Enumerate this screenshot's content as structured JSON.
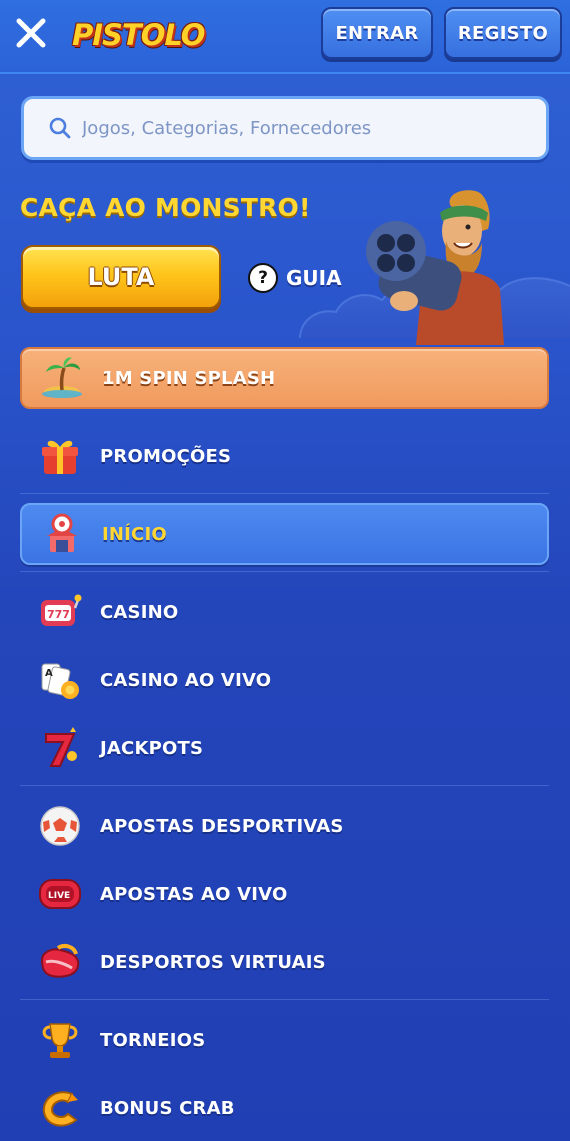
{
  "header": {
    "logo_text": "PISTOLO",
    "login_label": "ENTRAR",
    "register_label": "REGISTO"
  },
  "search": {
    "placeholder": "Jogos, Categorias, Fornecedores"
  },
  "promo": {
    "title": "CAÇA AO MONSTRO!",
    "fight_label": "LUTA",
    "guide_label": "GUIA",
    "guide_icon": "?"
  },
  "menu": {
    "items": [
      {
        "label": "1M SPIN SPLASH",
        "icon": "palm-island-icon"
      },
      {
        "label": "PROMOÇÕES",
        "icon": "gift-icon"
      },
      {
        "label": "INÍCIO",
        "icon": "home-target-icon"
      },
      {
        "label": "CASINO",
        "icon": "slot-machine-icon"
      },
      {
        "label": "CASINO AO VIVO",
        "icon": "cards-chip-icon"
      },
      {
        "label": "JACKPOTS",
        "icon": "lucky-seven-icon"
      },
      {
        "label": "APOSTAS DESPORTIVAS",
        "icon": "soccer-ball-icon"
      },
      {
        "label": "APOSTAS AO VIVO",
        "icon": "live-badge-icon"
      },
      {
        "label": "DESPORTOS VIRTUAIS",
        "icon": "vr-headset-icon"
      },
      {
        "label": "TORNEIOS",
        "icon": "trophy-icon"
      },
      {
        "label": "BONUS CRAB",
        "icon": "crab-claw-icon"
      }
    ],
    "live_badge_text": "LIVE",
    "jackpot_badge_text": "7"
  },
  "colors": {
    "background": "#2443b4",
    "accent_yellow": "#ffd733",
    "splash_orange": "#f09a5e",
    "active_blue": "#3b74e3"
  }
}
